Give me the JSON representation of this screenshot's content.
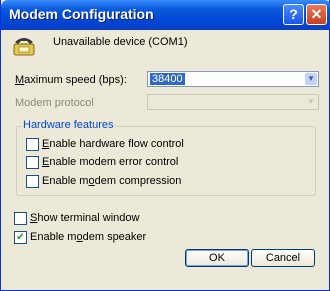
{
  "window": {
    "title": "Modem Configuration",
    "help_glyph": "?",
    "close_glyph": "✕"
  },
  "device": {
    "name": "Unavailable device (COM1)",
    "icon": "telephone-modem-icon"
  },
  "max_speed": {
    "label_pre": "M",
    "label_rest": "aximum speed (bps):",
    "value": "38400"
  },
  "modem_protocol": {
    "label": "Modem protocol",
    "value": ""
  },
  "hardware": {
    "title": "Hardware features",
    "items": [
      {
        "label_pre": "E",
        "label_rest": "nable hardware flow control",
        "checked": false
      },
      {
        "label_pre": "E",
        "label_rest": "nable modem error control",
        "checked": false
      },
      {
        "label_pre": "Enable m",
        "label_u": "o",
        "label_rest": "dem compression",
        "checked": false
      }
    ]
  },
  "options": [
    {
      "label_pre": "S",
      "label_rest": "how terminal window",
      "checked": false
    },
    {
      "label_pre": "Enable m",
      "label_u": "o",
      "label_rest": "dem speaker",
      "checked": true
    }
  ],
  "buttons": {
    "ok": "OK",
    "cancel": "Cancel"
  },
  "colors": {
    "titlebar": "#0a5bdb",
    "selection": "#316ac5",
    "group_title": "#0046d5"
  }
}
